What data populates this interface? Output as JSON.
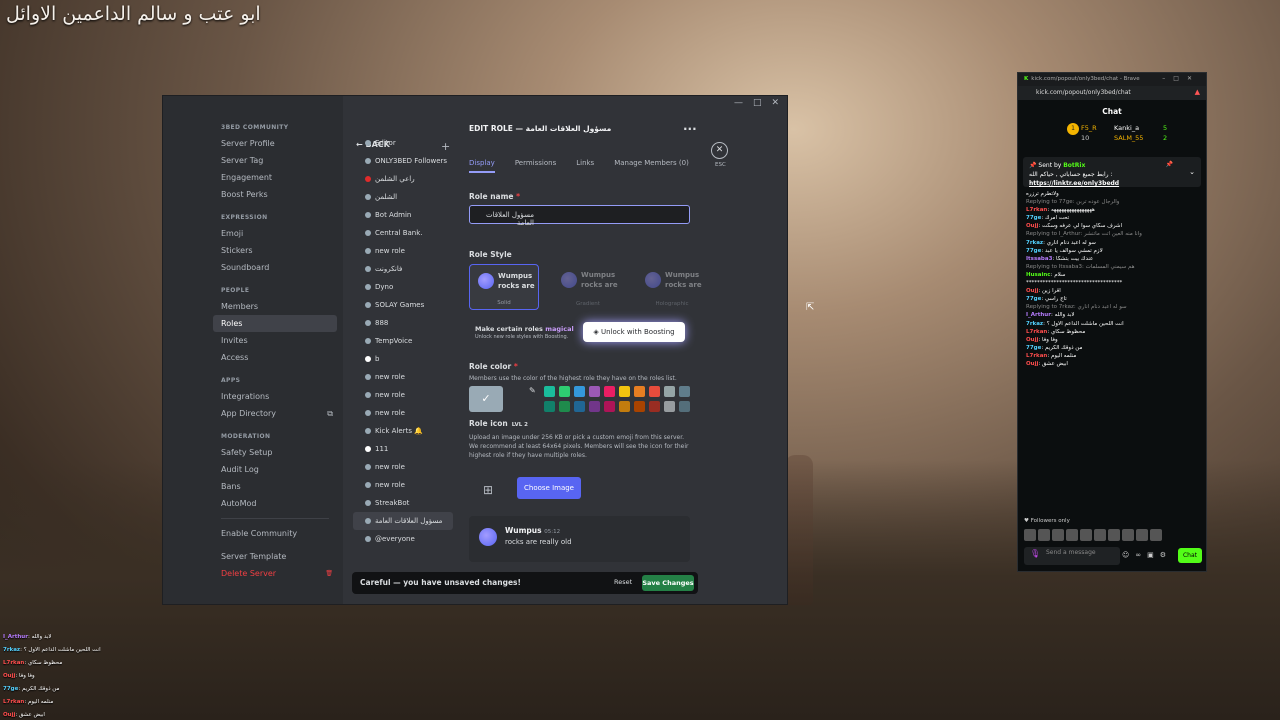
{
  "overlay": {
    "title": "ابو عتب و سالم الداعمين الاوائل"
  },
  "discord": {
    "window_buttons": [
      "—",
      "□",
      "✕"
    ],
    "nav": [
      {
        "section": "3BED COMMUNITY",
        "items": [
          "Server Profile",
          "Server Tag",
          "Engagement",
          "Boost Perks"
        ]
      },
      {
        "section": "EXPRESSION",
        "items": [
          "Emoji",
          "Stickers",
          "Soundboard"
        ]
      },
      {
        "section": "PEOPLE",
        "items": [
          "Members",
          "Roles",
          "Invites",
          "Access"
        ]
      },
      {
        "section": "APPS",
        "items": [
          "Integrations",
          "App Directory"
        ]
      },
      {
        "section": "MODERATION",
        "items": [
          "Safety Setup",
          "Audit Log",
          "Bans",
          "AutoMod"
        ]
      }
    ],
    "nav_extra": [
      "Enable Community",
      "Server Template",
      "Delete Server"
    ],
    "active_nav": "Roles",
    "back_label": "BACK",
    "roles": [
      {
        "name": "Editor",
        "color": "#99aab5"
      },
      {
        "name": "ONLY3BED Followers",
        "color": "#99aab5"
      },
      {
        "name": "راعي الشلمن",
        "color": "#e02b2b"
      },
      {
        "name": "الشلمن",
        "color": "#99aab5"
      },
      {
        "name": "Bot Admin",
        "color": "#99aab5"
      },
      {
        "name": "Central Bank.",
        "color": "#99aab5"
      },
      {
        "name": "new role",
        "color": "#99aab5"
      },
      {
        "name": "فانكرونت",
        "color": "#99aab5"
      },
      {
        "name": "Dyno",
        "color": "#99aab5"
      },
      {
        "name": "SOLAY Games",
        "color": "#99aab5"
      },
      {
        "name": "888",
        "color": "#99aab5"
      },
      {
        "name": "TempVoice",
        "color": "#99aab5"
      },
      {
        "name": "b",
        "color": "#ffffff"
      },
      {
        "name": "new role",
        "color": "#99aab5"
      },
      {
        "name": "new role",
        "color": "#99aab5"
      },
      {
        "name": "new role",
        "color": "#99aab5"
      },
      {
        "name": "Kick Alerts 🔔",
        "color": "#99aab5"
      },
      {
        "name": "111",
        "color": "#ffffff"
      },
      {
        "name": "new role",
        "color": "#99aab5"
      },
      {
        "name": "new role",
        "color": "#99aab5"
      },
      {
        "name": "StreakBot",
        "color": "#99aab5"
      },
      {
        "name": "مسؤول العلاقات العامة",
        "color": "#99aab5"
      },
      {
        "name": "@everyone",
        "color": "#99aab5"
      }
    ],
    "edit": {
      "title": "EDIT ROLE — مسؤول العلاقات العامة",
      "tabs": [
        "Display",
        "Permissions",
        "Links",
        "Manage Members (0)"
      ],
      "esc": "ESC",
      "role_name_label": "Role name",
      "role_name_value": "مسؤول العلاقات العامة",
      "role_style_label": "Role Style",
      "style_cards": [
        {
          "caption": "Solid",
          "text": "Wumpus rocks are"
        },
        {
          "caption": "Gradient",
          "text": "Wumpus rocks are"
        },
        {
          "caption": "Holographic",
          "text": "Wumpus rocks are"
        }
      ],
      "magic_title": "Make certain roles",
      "magic_word": "magical",
      "magic_sub": "Unlock new role styles with Boosting.",
      "boost_label": "Unlock with Boosting",
      "role_color_label": "Role color",
      "role_color_help": "Members use the color of the highest role they have on the roles list.",
      "default_color": "#99aab5",
      "swatches": [
        "#1abc9c",
        "#2ecc71",
        "#3498db",
        "#9b59b6",
        "#e91e63",
        "#f1c40f",
        "#e67e22",
        "#e74c3c",
        "#95a5a6",
        "#607d8b",
        "#11806a",
        "#1f8b4c",
        "#206694",
        "#71368a",
        "#ad1457",
        "#c27c0e",
        "#a84300",
        "#992d22",
        "#979c9f",
        "#546e7a"
      ],
      "role_icon_label": "Role icon",
      "role_icon_lvl": "LVL 2",
      "role_icon_help": "Upload an image under 256 KB or pick a custom emoji from this server. We recommend at least 64x64 pixels. Members will see the icon for their highest role if they have multiple roles.",
      "choose_image": "Choose Image",
      "preview_name": "Wumpus",
      "preview_time": "05:12",
      "preview_msg": "rocks are really old",
      "unsaved_text": "Careful — you have unsaved changes!",
      "reset": "Reset",
      "save": "Save Changes"
    }
  },
  "kick": {
    "titlebar": "kick.com/popout/only3bed/chat - Brave",
    "url": "kick.com/popout/only3bed/chat",
    "chat_title": "Chat",
    "gifters": [
      {
        "rank": "1",
        "name": "F5_R",
        "count": "10"
      },
      {
        "name": "Kanki_a",
        "count": "5"
      },
      {
        "name": "SALM_55",
        "count": "2"
      }
    ],
    "pinned_by": "Sent by",
    "pinned_bot": "BotRix",
    "pinned_text": "رابط جميع حساباتي , حياكم الله :",
    "pinned_link": "https://linktr.ee/only3bedd",
    "messages": [
      {
        "type": "msg",
        "user": "",
        "text": "ولاتطرم ترزره",
        "color": "#fff"
      },
      {
        "type": "reply",
        "text": "Replying to 77ge: والرجال عوده تربن"
      },
      {
        "type": "msg",
        "user": "L7rkan",
        "text": "ههههههههههههههههه",
        "color": "#ff4d4d"
      },
      {
        "type": "msg",
        "user": "77ge",
        "text": "تحت امرك",
        "color": "#53d1ff"
      },
      {
        "type": "msg",
        "user": "Oujj",
        "text": "اشرف سكاي سوا لي عرفه وسكت",
        "color": "#ff4d4d"
      },
      {
        "type": "reply",
        "text": "Replying to I_Arthur: وانا منه العين اتت ماتنشر"
      },
      {
        "type": "msg",
        "user": "7rkaz",
        "text": "سو له اعبد دنام اناري",
        "color": "#53d1ff"
      },
      {
        "type": "msg",
        "user": "77ge",
        "text": "لازم تمشي سوالف يا عبد",
        "color": "#53d1ff"
      },
      {
        "type": "msg",
        "user": "Itssaba3",
        "text": "عندك بيت بتشكا",
        "color": "#b77dff"
      },
      {
        "type": "reply",
        "text": "Replying to Itssaba3: هم سيمني المسلمات"
      },
      {
        "type": "msg",
        "user": "Husainc",
        "text": "سلام",
        "color": "#53fc18"
      },
      {
        "type": "msg",
        "user": "",
        "text": "***********************************",
        "color": "#fff"
      },
      {
        "type": "msg",
        "user": "Oujj",
        "text": "اقرا زين",
        "color": "#ff4d4d"
      },
      {
        "type": "msg",
        "user": "77ge",
        "text": "تاج راسي",
        "color": "#53d1ff"
      },
      {
        "type": "reply",
        "text": "Replying to 7rkaz: سو له اعبد دنام اناري"
      },
      {
        "type": "msg",
        "user": "I_Arthur",
        "text": "لابد والله",
        "color": "#b77dff"
      },
      {
        "type": "msg",
        "user": "7rkaz",
        "text": "انت اللحين ماشلت الداعم الاول ؟",
        "color": "#53d1ff"
      },
      {
        "type": "msg",
        "user": "L7rkan",
        "text": "محظوظ سكاي",
        "color": "#ff4d4d"
      },
      {
        "type": "msg",
        "user": "Oujj",
        "text": "وفا وفا",
        "color": "#ff4d4d"
      },
      {
        "type": "msg",
        "user": "77ge",
        "text": "من ذوقك الكريم",
        "color": "#53d1ff"
      },
      {
        "type": "msg",
        "user": "L7rkan",
        "text": "منلمه اليوم",
        "color": "#ff4d4d"
      },
      {
        "type": "msg",
        "user": "Oujj",
        "text": "ابيض عشق",
        "color": "#ff4d4d"
      }
    ],
    "followers_only": "Followers only",
    "send_placeholder": "Send a message",
    "send_button": "Chat"
  },
  "overlay_chat": [
    {
      "user": "I_Arthur",
      "text": "لابد والله",
      "color": "#b77dff"
    },
    {
      "user": "7rkaz",
      "text": "انت اللحين ماشلت الداعم الاول ؟",
      "color": "#53d1ff"
    },
    {
      "user": "L7rkan",
      "text": "محظوظ سكاي",
      "color": "#ff4d4d"
    },
    {
      "user": "Oujj",
      "text": "وفا وفا",
      "color": "#ff4d4d"
    },
    {
      "user": "77ge",
      "text": "من ذوقك الكريم",
      "color": "#53d1ff"
    },
    {
      "user": "L7rkan",
      "text": "منلمه اليوم",
      "color": "#ff4d4d"
    },
    {
      "user": "Oujj",
      "text": "ابيض عشق",
      "color": "#ff4d4d"
    }
  ]
}
